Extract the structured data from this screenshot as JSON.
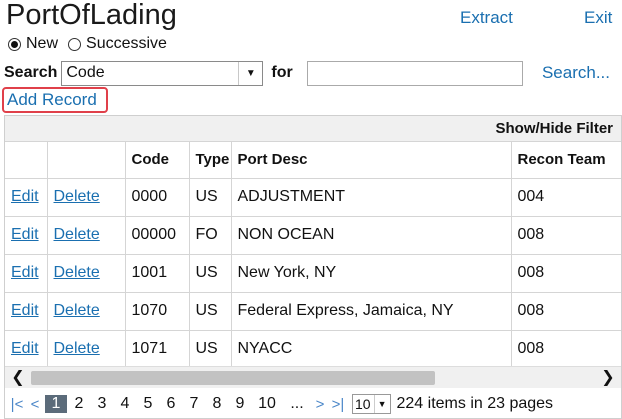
{
  "page": {
    "title": "PortOfLading",
    "extract_label": "Extract",
    "exit_label": "Exit"
  },
  "mode": {
    "new_label": "New",
    "successive_label": "Successive",
    "selected": "New"
  },
  "search": {
    "label": "Search",
    "field_value": "Code",
    "for_label": "for",
    "input_value": "",
    "search_label": "Search..."
  },
  "add_record_label": "Add Record",
  "grid": {
    "filter_label": "Show/Hide Filter",
    "columns": [
      "",
      "",
      "Code",
      "Type",
      "Port Desc",
      "Recon Team"
    ],
    "rows": [
      {
        "edit": "Edit",
        "delete": "Delete",
        "code": "0000",
        "type": "US",
        "desc": "ADJUSTMENT",
        "team": "004"
      },
      {
        "edit": "Edit",
        "delete": "Delete",
        "code": "00000",
        "type": "FO",
        "desc": "NON OCEAN",
        "team": "008"
      },
      {
        "edit": "Edit",
        "delete": "Delete",
        "code": "1001",
        "type": "US",
        "desc": "New York, NY",
        "team": "008"
      },
      {
        "edit": "Edit",
        "delete": "Delete",
        "code": "1070",
        "type": "US",
        "desc": "Federal Express, Jamaica, NY",
        "team": "008"
      },
      {
        "edit": "Edit",
        "delete": "Delete",
        "code": "1071",
        "type": "US",
        "desc": "NYACC",
        "team": "008"
      }
    ]
  },
  "pager": {
    "pages": [
      "1",
      "2",
      "3",
      "4",
      "5",
      "6",
      "7",
      "8",
      "9",
      "10",
      "..."
    ],
    "current": "1",
    "page_size": "10",
    "summary": "224 items in 23 pages",
    "first_icon": "|<",
    "prev_icon": "<",
    "next_icon": ">",
    "last_icon": ">|"
  },
  "icons": {
    "scroll_left": "chevron-left-icon",
    "scroll_right": "chevron-right-icon",
    "dropdown": "caret-down-icon"
  }
}
